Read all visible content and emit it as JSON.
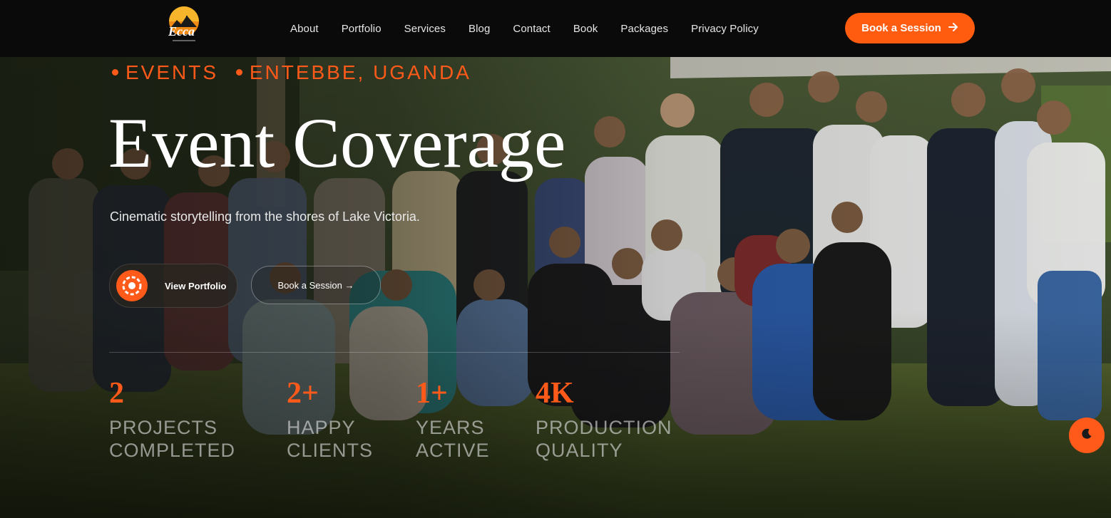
{
  "header": {
    "logo_text": "Ecca",
    "nav": [
      "About",
      "Portfolio",
      "Services",
      "Blog",
      "Contact",
      "Book",
      "Packages",
      "Privacy Policy"
    ],
    "cta_label": "Book a Session",
    "cta_icon": "arrow-right-icon"
  },
  "hero": {
    "eyebrow_1": "EVENTS",
    "eyebrow_2": "ENTEBBE, UGANDA",
    "title": "Event Coverage",
    "subtitle": "Cinematic storytelling from the shores of Lake Victoria.",
    "primary_button": "View Portfolio",
    "secondary_button": "Book a Session →",
    "stats": [
      {
        "value": "2",
        "label_1": "PROJECTS",
        "label_2": "COMPLETED"
      },
      {
        "value": "2+",
        "label_1": "HAPPY",
        "label_2": "CLIENTS"
      },
      {
        "value": "1+",
        "label_1": "YEARS",
        "label_2": "ACTIVE"
      },
      {
        "value": "4K",
        "label_1": "PRODUCTION",
        "label_2": "QUALITY"
      }
    ]
  },
  "theme_toggle_icon": "moon-icon",
  "colors": {
    "accent": "#ff5c0f",
    "header_bg": "#0a0a0a",
    "text": "#ffffff"
  }
}
